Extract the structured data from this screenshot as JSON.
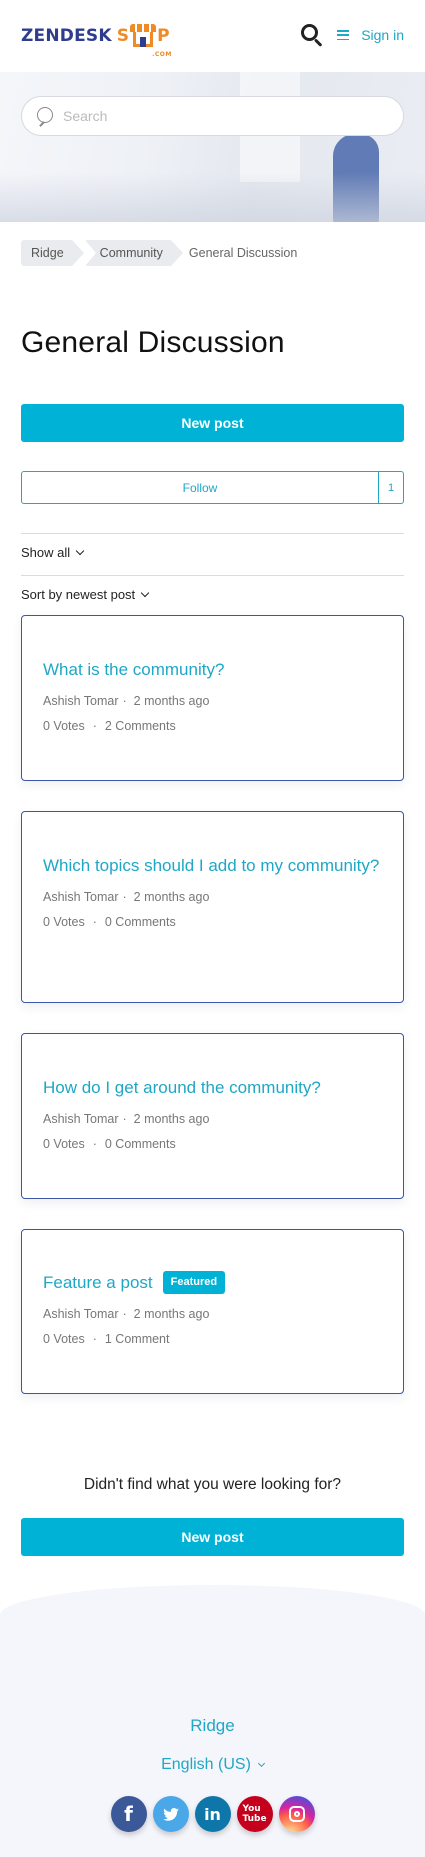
{
  "header": {
    "logo_text_left": "ZENDESK",
    "logo_s": "S",
    "logo_p": "P",
    "logo_com": ".COM",
    "signin_label": "Sign in"
  },
  "search": {
    "placeholder": "Search"
  },
  "breadcrumb": {
    "items": [
      "Ridge",
      "Community"
    ],
    "current": "General Discussion"
  },
  "page_title": "General Discussion",
  "new_post_label": "New post",
  "follow": {
    "label": "Follow",
    "count": "1"
  },
  "filters": {
    "show": "Show all",
    "sort": "Sort by newest post"
  },
  "posts": [
    {
      "title": "What is the community?",
      "author": "Ashish Tomar",
      "time": "2 months ago",
      "votes": "0 Votes",
      "comments": "2 Comments",
      "badge": ""
    },
    {
      "title": "Which topics should I add to my community?",
      "author": "Ashish Tomar",
      "time": "2 months ago",
      "votes": "0 Votes",
      "comments": "0 Comments",
      "badge": ""
    },
    {
      "title": "How do I get around the community?",
      "author": "Ashish Tomar",
      "time": "2 months ago",
      "votes": "0 Votes",
      "comments": "0 Comments",
      "badge": ""
    },
    {
      "title": "Feature a post",
      "author": "Ashish Tomar",
      "time": "2 months ago",
      "votes": "0 Votes",
      "comments": "1 Comment",
      "badge": "Featured"
    }
  ],
  "help_text": "Didn't find what you were looking for?",
  "footer": {
    "brand": "Ridge",
    "language": "English (US)",
    "socials": [
      "facebook",
      "twitter",
      "linkedin",
      "youtube",
      "instagram"
    ]
  },
  "colors": {
    "accent": "#00b2d6",
    "link": "#1fa7c6",
    "card_border": "#3b56a6",
    "logo_blue": "#2f3d8f",
    "logo_orange": "#f08a24"
  }
}
